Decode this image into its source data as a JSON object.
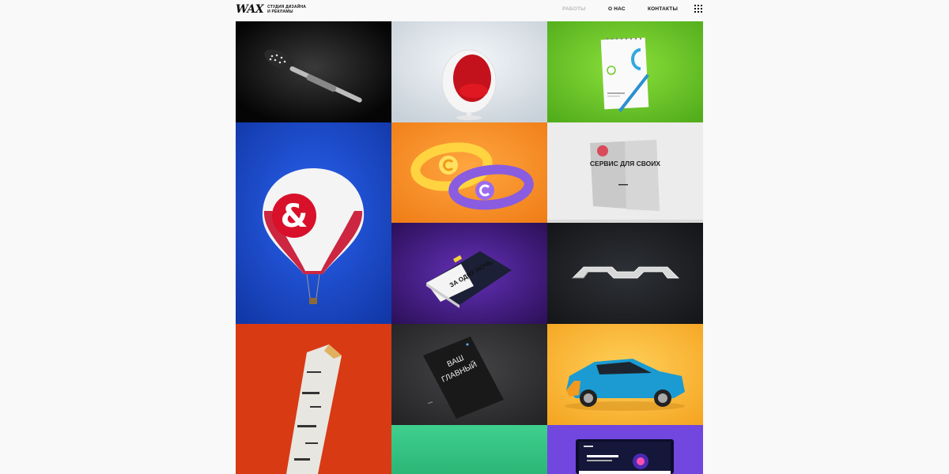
{
  "header": {
    "logo_mark": "WAX",
    "logo_line1": "СТУДИЯ ДИЗАЙНА",
    "logo_line2": "И РЕКЛАМЫ",
    "nav": [
      {
        "label": "РАБОТЫ",
        "active": true
      },
      {
        "label": "О НАС",
        "active": false
      },
      {
        "label": "КОНТАКТЫ",
        "active": false
      }
    ],
    "menu_icon": "grid-menu-icon"
  },
  "portfolio": {
    "tiles": [
      {
        "name": "caviar-spoon",
        "color": "#0f0f0f"
      },
      {
        "name": "egg-chair",
        "color": "#dde4ea"
      },
      {
        "name": "notebook-branding",
        "color": "#6fcb2a"
      },
      {
        "name": "hot-air-balloon",
        "color": "#1c4bd0"
      },
      {
        "name": "wristbands",
        "color": "#f7922a"
      },
      {
        "name": "service-brochure",
        "color": "#ececec",
        "headline": "СЕРВИС ДЛЯ СВОИХ"
      },
      {
        "name": "book-cover",
        "color": "#4a1f8c",
        "title": "ЗА ОДНУ НОЧЬ"
      },
      {
        "name": "chrome-logo",
        "color": "#202226"
      },
      {
        "name": "birch-log",
        "color": "#d93a14"
      },
      {
        "name": "poster",
        "color": "#343436",
        "line1": "ВАШ",
        "line2": "ГЛАВНЫЙ"
      },
      {
        "name": "car",
        "color": "#fbb93c"
      },
      {
        "name": "green-tile",
        "color": "#35c484"
      },
      {
        "name": "website-mockup",
        "color": "#7147e0"
      }
    ]
  }
}
